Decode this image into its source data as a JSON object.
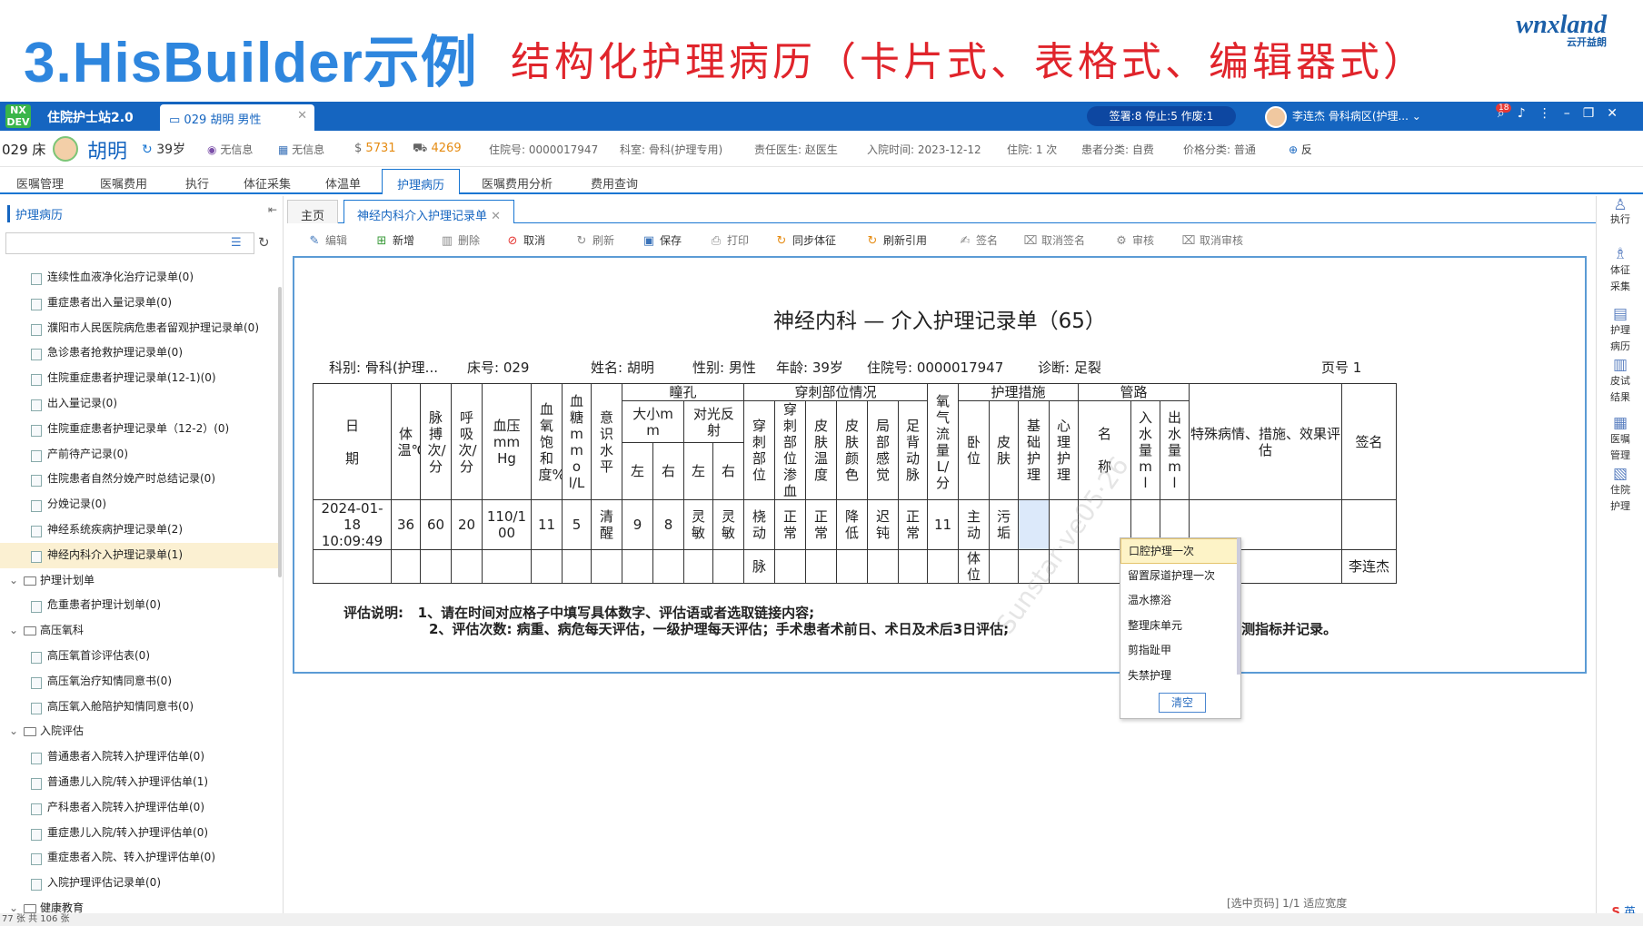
{
  "slide": {
    "title": "3.HisBuilder示例",
    "subtitle": "结构化护理病历（卡片式、表格式、编辑器式）",
    "logo": "wnxland",
    "logo_sub": "云开益朗"
  },
  "titlebar": {
    "badge": "NX DEV",
    "app_name": "住院护士站2.0",
    "patient_tab": "029 胡明 男性",
    "counters": "签署:8  停止:5  作废:1",
    "user": "李连杰  骨科病区(护理...",
    "notifications": "18"
  },
  "patient": {
    "bed": "029 床",
    "name": "胡明",
    "age": "39岁",
    "info1": "无信息",
    "info2": "无信息",
    "balance1": "5731",
    "balance2": "4269",
    "admission_no": "住院号: 0000017947",
    "dept": "科室: 骨科(护理专用)",
    "doctor": "责任医生: 赵医生",
    "admit_time": "入院时间: 2023-12-12",
    "admit_count": "住院: 1 次",
    "category": "患者分类: 自费",
    "price_cat": "价格分类: 普通",
    "extra": "反"
  },
  "nav_tabs": [
    "医嘱管理",
    "医嘱费用",
    "执行",
    "体征采集",
    "体温单",
    "护理病历",
    "医嘱费用分析",
    "费用查询"
  ],
  "sidebar": {
    "title": "护理病历",
    "items": [
      {
        "type": "leaf",
        "label": "连续性血液净化治疗记录单(0)"
      },
      {
        "type": "leaf",
        "label": "重症患者出入量记录单(0)"
      },
      {
        "type": "leaf",
        "label": "濮阳市人民医院病危患者留观护理记录单(0)"
      },
      {
        "type": "leaf",
        "label": "急诊患者抢救护理记录单(0)"
      },
      {
        "type": "leaf",
        "label": "住院重症患者护理记录单(12-1)(0)"
      },
      {
        "type": "leaf",
        "label": "出入量记录(0)"
      },
      {
        "type": "leaf",
        "label": "住院重症患者护理记录单（12-2）(0)"
      },
      {
        "type": "leaf",
        "label": "产前待产记录(0)"
      },
      {
        "type": "leaf",
        "label": "住院患者自然分娩产时总结记录(0)"
      },
      {
        "type": "leaf",
        "label": "分娩记录(0)"
      },
      {
        "type": "leaf",
        "label": "神经系统疾病护理记录单(2)"
      },
      {
        "type": "leaf",
        "label": "神经内科介入护理记录单(1)",
        "selected": true
      },
      {
        "type": "group",
        "label": "护理计划单"
      },
      {
        "type": "leaf",
        "label": "危重患者护理计划单(0)"
      },
      {
        "type": "group",
        "label": "高压氧科"
      },
      {
        "type": "leaf",
        "label": "高压氧首诊评估表(0)"
      },
      {
        "type": "leaf",
        "label": "高压氧治疗知情同意书(0)"
      },
      {
        "type": "leaf",
        "label": "高压氧入舱陪护知情同意书(0)"
      },
      {
        "type": "group",
        "label": "入院评估"
      },
      {
        "type": "leaf",
        "label": "普通患者入院转入护理评估单(0)"
      },
      {
        "type": "leaf",
        "label": "普通患儿入院/转入护理评估单(1)"
      },
      {
        "type": "leaf",
        "label": "产科患者入院转入护理评估单(0)"
      },
      {
        "type": "leaf",
        "label": "重症患儿入院/转入护理评估单(0)"
      },
      {
        "type": "leaf",
        "label": "重症患者入院、转入护理评估单(0)"
      },
      {
        "type": "leaf",
        "label": "入院护理评估记录单(0)"
      },
      {
        "type": "group",
        "label": "健康教育"
      }
    ]
  },
  "content_tabs": [
    "主页",
    "神经内科介入护理记录单"
  ],
  "toolbar": [
    "编辑",
    "新增",
    "删除",
    "取消",
    "刷新",
    "保存",
    "打印",
    "同步体征",
    "刷新引用",
    "签名",
    "取消签名",
    "审核",
    "取消审核"
  ],
  "form": {
    "title": "神经内科 — 介入护理记录单（65）",
    "dept": "科别:  骨科(护理...",
    "bed": "床号:  029",
    "name": "姓名:  胡明",
    "sex": "性别:  男性",
    "age": "年龄:     39岁",
    "admission": "住院号:    0000017947",
    "diagnosis": "诊断:    足裂",
    "page": "页号 1",
    "headers": {
      "date": "日",
      "date2": "期",
      "temp": "体温℃",
      "pulse": "脉搏次/分",
      "resp": "呼吸次/分",
      "bp": "血压mmHg",
      "spo2": "血氧饱和度%",
      "glucose": "血糖mmol/L",
      "conscious": "意识水平",
      "pupil": "瞳孔",
      "pupil_size": "大小mm",
      "pupil_light": "对光反射",
      "left": "左",
      "right": "右",
      "puncture": "穿刺部位情况",
      "p_site": "穿刺部位",
      "p_ooze": "穿刺部位渗血",
      "skin_temp": "皮肤温度",
      "skin_color": "皮肤颜色",
      "local_sense": "局部感觉",
      "dorsal": "足背动脉",
      "oxygen": "氧气流量L/分",
      "measures": "护理措施",
      "position": "卧位",
      "skin": "皮肤",
      "basic": "基础护理",
      "psych": "心理护理",
      "pipeline": "管路",
      "pipe_name": "名",
      "pipe_name2": "称",
      "intake": "入水量ml",
      "output": "出水量ml",
      "special": "特殊病情、措施、效果评估",
      "sign": "签名"
    },
    "row1": {
      "date": "2024-01-18",
      "time": "10:09:49",
      "temp": "36",
      "pulse": "60",
      "resp": "20",
      "bp": "110/100",
      "spo2": "11",
      "glucose": "5",
      "conscious": "清醒",
      "pl": "9",
      "pr": "8",
      "ll": "灵敏",
      "lr": "灵敏",
      "p_site": "桡动",
      "p_ooze": "正常",
      "skin_temp": "正常",
      "skin_color": "降低",
      "local_sense": "迟钝",
      "dorsal": "正常",
      "oxygen": "11",
      "position": "主动",
      "skin": "污垢"
    },
    "row2": {
      "p_site": "脉",
      "position": "体位",
      "sign": "李连杰"
    },
    "note_label": "评估说明:",
    "note1": "1、请在时间对应格子中填写具体数字、评估语或者选取链接内容;",
    "note2": "2、评估次数: 病重、病危每天评估，一级护理每天评估；手术患者术前日、术日及术后3日评估;",
    "note2_tail": "时评估；据医嘱检测指标并记录。"
  },
  "dropdown": {
    "items": [
      "口腔护理一次",
      "留置尿道护理一次",
      "温水擦浴",
      "整理床单元",
      "剪指趾甲",
      "失禁护理"
    ],
    "clear": "清空"
  },
  "right_rail": [
    "执行",
    "体征采集",
    "护理病历",
    "皮试结果",
    "医嘱管理",
    "住院护理"
  ],
  "pager": "[选中页码]      1/1          适应宽度",
  "status": "77 张    共 106 张",
  "ime": "英"
}
